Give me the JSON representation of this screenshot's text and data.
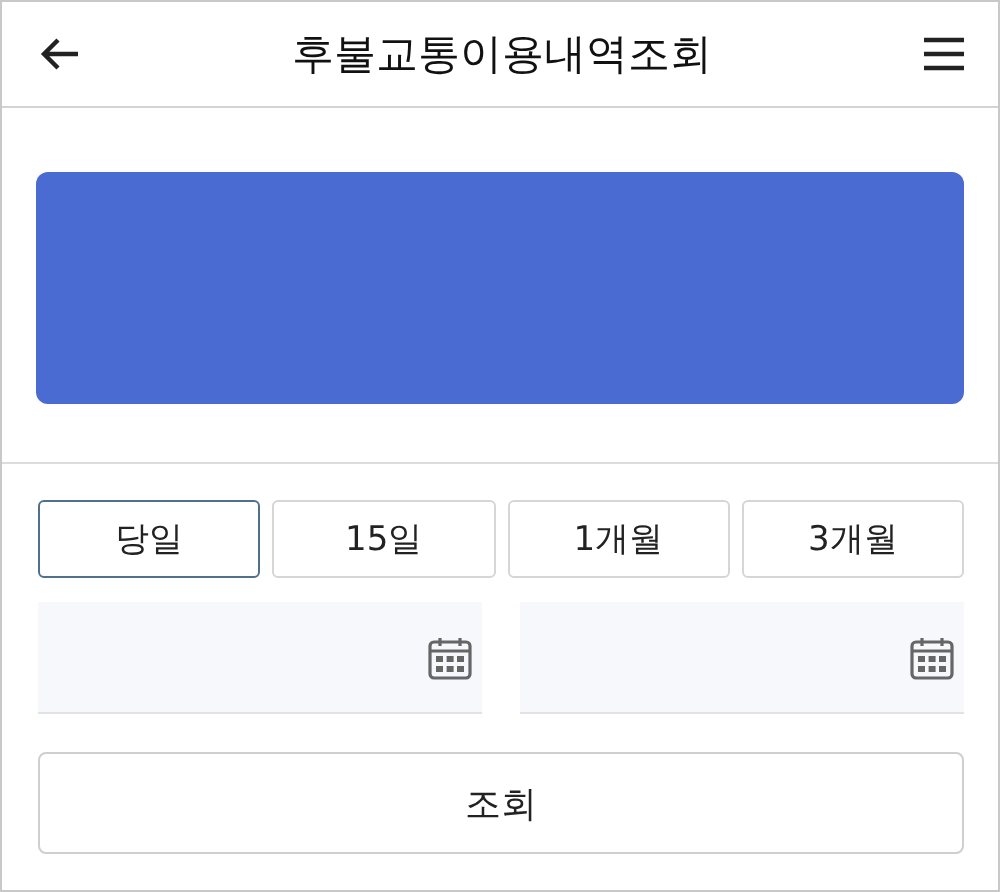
{
  "header": {
    "title": "후불교통이용내역조회"
  },
  "period_tabs": [
    {
      "label": "당일",
      "selected": true
    },
    {
      "label": "15일",
      "selected": false
    },
    {
      "label": "1개월",
      "selected": false
    },
    {
      "label": "3개월",
      "selected": false
    }
  ],
  "search_button": {
    "label": "조회"
  }
}
